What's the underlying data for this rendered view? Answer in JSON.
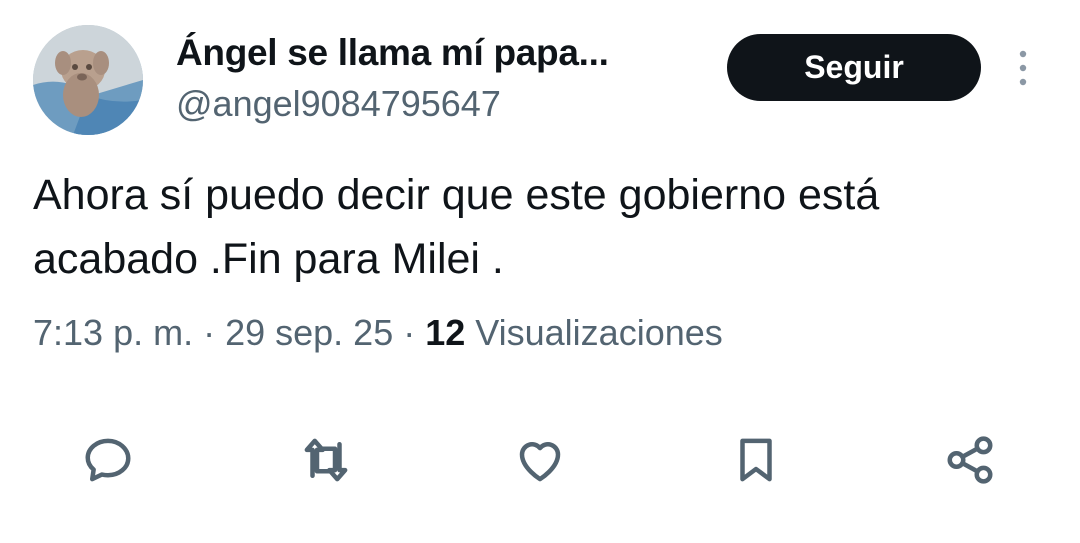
{
  "author": {
    "display_name": "Ángel se llama mí papa...",
    "handle": "@angel9084795647",
    "avatar_icon": "dog-photo-avatar"
  },
  "follow_button": {
    "label": "Seguir",
    "background": "#0f1419",
    "text_color": "#ffffff"
  },
  "more_icon": "more-vertical-icon",
  "tweet": {
    "text_line1": "Ahora sí puedo decir que este gobierno está",
    "text_line2": "acabado .Fin para Milei ."
  },
  "meta": {
    "time": "7:13 p. m.",
    "separator1": " · ",
    "date": "29 sep. 25",
    "separator2": " · ",
    "views_count": "12",
    "views_label": " Visualizaciones"
  },
  "actions": [
    {
      "name": "reply",
      "icon": "reply-icon"
    },
    {
      "name": "retweet",
      "icon": "retweet-icon"
    },
    {
      "name": "like",
      "icon": "heart-icon"
    },
    {
      "name": "bookmark",
      "icon": "bookmark-icon"
    },
    {
      "name": "share",
      "icon": "share-icon"
    }
  ],
  "colors": {
    "text_primary": "#0f1419",
    "text_secondary": "#536471",
    "icon": "#536471"
  }
}
